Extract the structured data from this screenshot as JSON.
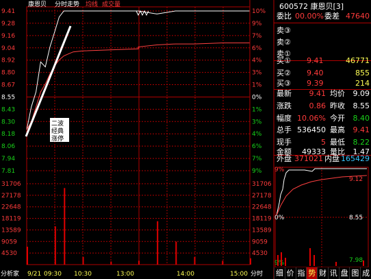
{
  "chart_header": {
    "stock_name": "康恩贝",
    "view_label": "分时走势",
    "legend_avg": "均线",
    "legend_vol": "成交量"
  },
  "price_axis_left": [
    "9.41",
    "9.28",
    "9.16",
    "9.04",
    "8.92",
    "8.80",
    "8.67",
    "8.55",
    "8.43",
    "8.30",
    "8.18",
    "8.06",
    "7.94",
    "7.81"
  ],
  "pct_axis_right": [
    "10%",
    "9%",
    "7%",
    "6%",
    "4%",
    "3%",
    "1%",
    "0%",
    "1%",
    "3%",
    "4%",
    "6%",
    "7%",
    "9%"
  ],
  "volume_axis": [
    "31706",
    "27178",
    "22648",
    "18119",
    "13589",
    "9059",
    "4530"
  ],
  "time_axis": [
    "分析家",
    "9/21",
    "09:30",
    "10:30",
    "13:00",
    "14:00",
    "15:00",
    "分时"
  ],
  "annotation": [
    "二波",
    "经典",
    "涨停"
  ],
  "panel": {
    "code_name": "600572 康恩贝[3]",
    "weibi_label": "委比",
    "weibi_value": "00.00%",
    "weicha_label": "委差",
    "weicha_value": "47640",
    "asks": [
      {
        "label": "卖③",
        "price": "",
        "vol": ""
      },
      {
        "label": "卖②",
        "price": "",
        "vol": ""
      },
      {
        "label": "卖①",
        "price": "",
        "vol": ""
      }
    ],
    "bids": [
      {
        "label": "买①",
        "price": "9.41",
        "vol": "46771"
      },
      {
        "label": "买②",
        "price": "9.40",
        "vol": "855"
      },
      {
        "label": "买③",
        "price": "9.39",
        "vol": "214"
      }
    ],
    "stats": [
      {
        "l1": "最新",
        "v1": "9.41",
        "c1": "red",
        "l2": "均价",
        "v2": "9.09",
        "c2": "white"
      },
      {
        "l1": "涨跌",
        "v1": "0.86",
        "c1": "red",
        "l2": "昨收",
        "v2": "8.55",
        "c2": "white"
      },
      {
        "l1": "幅度",
        "v1": "10.06%",
        "c1": "red",
        "l2": "今开",
        "v2": "8.40",
        "c2": "green"
      },
      {
        "l1": "总手",
        "v1": "536450",
        "c1": "white",
        "l2": "最高",
        "v2": "9.41",
        "c2": "red"
      },
      {
        "l1": "现手",
        "v1": "5",
        "c1": "red",
        "l2": "最低",
        "v2": "8.22",
        "c2": "green"
      },
      {
        "l1": "金额",
        "v1": "49333",
        "c1": "white",
        "l2": "量比",
        "v2": "1.47",
        "c2": "white"
      }
    ],
    "waipan_label": "外盘",
    "waipan_value": "371021",
    "neipan_label": "内盘",
    "neipan_value": "165429"
  },
  "mini_chart": {
    "top_pct": "9%",
    "mid_pct": "0%",
    "bot_pct": "9%",
    "prices": [
      "9.12",
      "8.55",
      "7.98"
    ],
    "time_label": "分时"
  },
  "bottom_tabs": [
    "细",
    "价",
    "指",
    "势",
    "财",
    "讯",
    "盘",
    "图",
    "成"
  ],
  "colors": {
    "background": "#000000",
    "grid": "#b00000",
    "price_line": "#ffffff",
    "avg_line": "#ff4040",
    "volume_bar": "#e00000",
    "up": "#ff3b3b",
    "down": "#19d219",
    "header_yellow": "#ffff55"
  },
  "chart_data": [
    {
      "type": "line",
      "title": "康恩贝 分时走势",
      "x": [
        "09:30",
        "09:35",
        "09:40",
        "09:45",
        "09:50",
        "09:55",
        "10:00",
        "10:05",
        "10:10",
        "10:15",
        "10:20",
        "10:30",
        "11:00",
        "11:30",
        "13:00",
        "13:20",
        "13:40",
        "14:00",
        "14:30",
        "15:00"
      ],
      "series": [
        {
          "name": "price",
          "values": [
            8.22,
            8.45,
            8.6,
            8.9,
            8.85,
            9.05,
            9.2,
            9.35,
            9.41,
            9.41,
            9.41,
            9.41,
            9.41,
            9.41,
            9.41,
            9.38,
            9.41,
            9.41,
            9.41,
            9.41
          ]
        },
        {
          "name": "均线",
          "values": [
            8.22,
            8.3,
            8.45,
            8.6,
            8.68,
            8.78,
            8.86,
            8.92,
            8.96,
            8.98,
            9.0,
            9.01,
            9.02,
            9.03,
            9.05,
            9.07,
            9.08,
            9.08,
            9.09,
            9.09
          ]
        }
      ],
      "ylim": [
        7.81,
        9.41
      ]
    },
    {
      "type": "bar",
      "title": "成交量",
      "x": [
        "09:30",
        "10:00",
        "10:10",
        "10:30",
        "11:00",
        "13:00",
        "13:20",
        "13:40",
        "14:00",
        "14:30",
        "15:00"
      ],
      "values": [
        7000,
        15000,
        30000,
        3000,
        1200,
        1500,
        17000,
        9000,
        3000,
        1500,
        2500
      ],
      "ylim": [
        0,
        31706
      ]
    }
  ]
}
